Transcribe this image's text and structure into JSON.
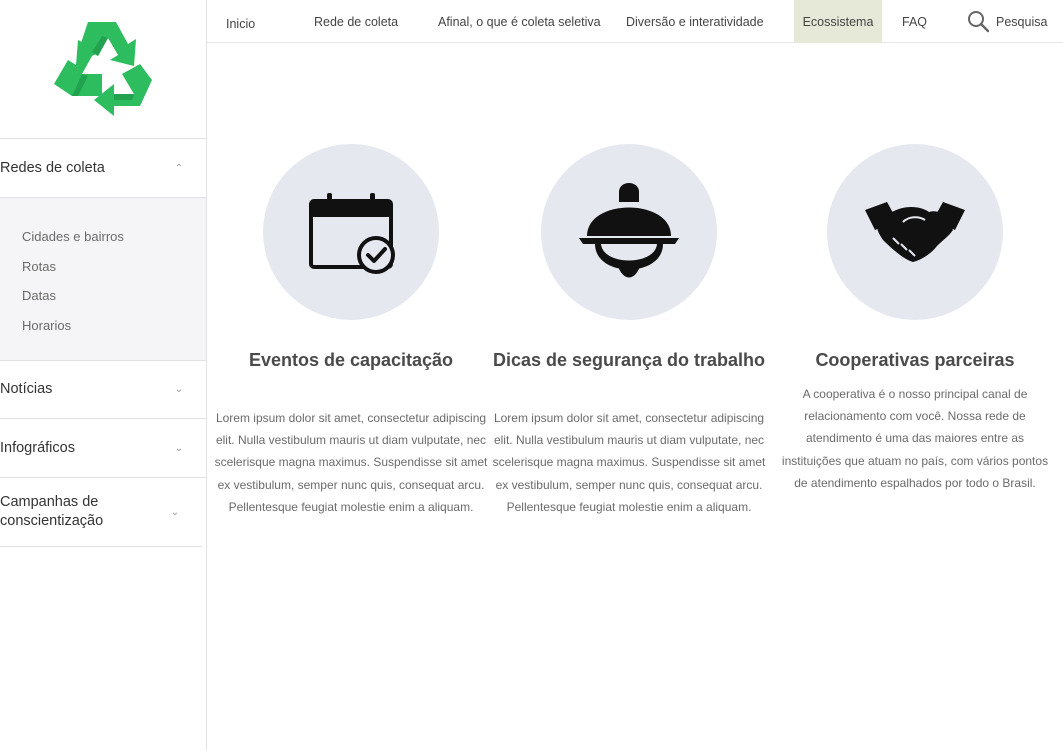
{
  "nav": {
    "items": [
      {
        "label": "Inicio"
      },
      {
        "label": "Rede de coleta"
      },
      {
        "label": "Afinal, o que é coleta seletiva"
      },
      {
        "label": "Diversão e interatividade"
      },
      {
        "label": "Ecossistema"
      },
      {
        "label": "FAQ"
      }
    ],
    "search_label": "Pesquisa",
    "active": "Ecossistema"
  },
  "sidebar": {
    "logo_icon": "recycle-icon",
    "sections": [
      {
        "label": "Redes de coleta",
        "expanded": true,
        "items": [
          "Cidades e bairros",
          "Rotas",
          "Datas",
          "Horarios"
        ]
      },
      {
        "label": "Notícias",
        "expanded": false
      },
      {
        "label": "Infográficos",
        "expanded": false
      },
      {
        "label": "Campanhas de conscientização",
        "expanded": false
      }
    ]
  },
  "cards": [
    {
      "icon": "calendar-check-icon",
      "title": "Eventos de capacitação",
      "text": "Lorem ipsum dolor sit amet, consectetur adipiscing elit. Nulla vestibulum mauris ut diam vulputate, nec scelerisque magna maximus. Suspendisse sit amet ex vestibulum, semper nunc quis, consequat arcu. Pellentesque feugiat molestie enim a aliquam."
    },
    {
      "icon": "safety-helmet-icon",
      "title": "Dicas de segurança do trabalho",
      "text": "Lorem ipsum dolor sit amet, consectetur adipiscing elit. Nulla vestibulum mauris ut diam vulputate, nec scelerisque magna maximus. Suspendisse sit amet ex vestibulum, semper nunc quis, consequat arcu. Pellentesque feugiat molestie enim a aliquam."
    },
    {
      "icon": "handshake-icon",
      "title": "Cooperativas parceiras",
      "text": "A cooperativa é o nosso principal canal de relacionamento com você. Nossa rede de atendimento é uma das maiores entre as instituições que atuam no país, com vários pontos de atendimento espalhados por todo o Brasil."
    }
  ],
  "colors": {
    "accent_green": "#2dbd5f",
    "circle_bg": "#e6e8f0",
    "active_tab_bg": "#e6e8d8"
  }
}
